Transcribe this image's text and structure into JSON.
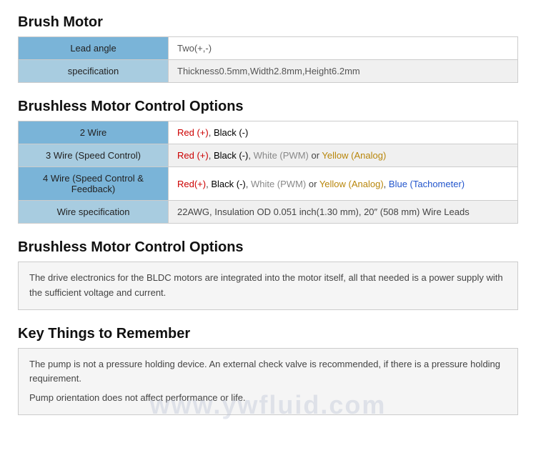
{
  "brush_motor": {
    "title": "Brush Motor",
    "rows": [
      {
        "label": "Lead angle",
        "value_raw": "Two(+,-)",
        "value_type": "plain"
      },
      {
        "label": "specification",
        "value_raw": "Thickness0.5mm,Width2.8mm,Height6.2mm",
        "value_type": "plain"
      }
    ]
  },
  "brushless_control": {
    "title": "Brushless Motor Control Options",
    "rows": [
      {
        "label": "2 Wire",
        "value_type": "colored"
      },
      {
        "label": "3 Wire (Speed Control)",
        "value_type": "colored"
      },
      {
        "label": "4 Wire (Speed Control & Feedback)",
        "value_type": "colored"
      },
      {
        "label": "Wire specification",
        "value_type": "colored"
      }
    ]
  },
  "brushless_desc": {
    "title": "Brushless Motor Control Options",
    "text": "The drive electronics for the BLDC motors are integrated into the motor itself, all that needed is a power supply with the sufficient voltage and current."
  },
  "key_things": {
    "title": "Key Things to Remember",
    "lines": [
      "The pump is not a pressure holding device. An external check valve is recommended, if there is a pressure holding requirement.",
      "Pump orientation does not affect performance or life."
    ]
  },
  "watermark": "www.ywfluid.com"
}
